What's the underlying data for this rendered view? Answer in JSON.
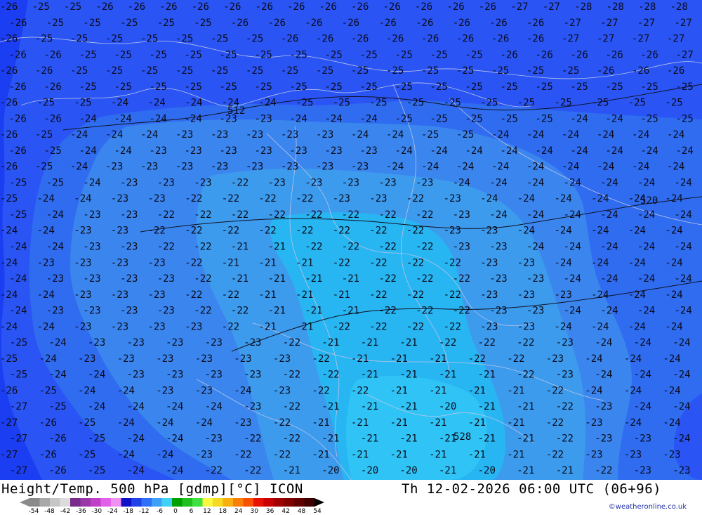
{
  "map": {
    "colors": {
      "band_26": "#1c3ef2",
      "band_25": "#2a55f4",
      "band_24": "#2f6cf0",
      "band_23": "#3b86ee",
      "band_22": "#3d9bee",
      "band_21": "#28b6f2",
      "contour": "#111122",
      "border": "#b9c3e6"
    },
    "temperature_labels": [
      {
        "row": 0,
        "values": [
          "-26",
          "-25",
          "-25",
          "-26",
          "-26",
          "-26",
          "-26",
          "-26",
          "-26",
          "-26",
          "-26",
          "-26",
          "-26",
          "-26",
          "-26",
          "-26",
          "-27",
          "-27",
          "-28",
          "-28",
          "-28",
          "-28"
        ]
      },
      {
        "row": 1,
        "values": [
          "-26",
          "-25",
          "-25",
          "-25",
          "-25",
          "-25",
          "-26",
          "-26",
          "-26",
          "-26",
          "-26",
          "-26",
          "-26",
          "-26",
          "-26",
          "-27",
          "-27",
          "-27",
          "-27"
        ]
      },
      {
        "row": 2,
        "values": [
          "-26",
          "-25",
          "-25",
          "-25",
          "-25",
          "-25",
          "-25",
          "-25",
          "-26",
          "-26",
          "-26",
          "-26",
          "-26",
          "-26",
          "-26",
          "-26",
          "-27",
          "-27",
          "-27",
          "-27"
        ]
      },
      {
        "row": 3,
        "values": [
          "-26",
          "-26",
          "-25",
          "-25",
          "-25",
          "-25",
          "-25",
          "-25",
          "-25",
          "-25",
          "-25",
          "-25",
          "-25",
          "-25",
          "-26",
          "-26",
          "-26",
          "-26",
          "-26",
          "-27"
        ]
      },
      {
        "row": 4,
        "values": [
          "-26",
          "-26",
          "-25",
          "-25",
          "-25",
          "-25",
          "-25",
          "-25",
          "-25",
          "-25",
          "-25",
          "-25",
          "-25",
          "-25",
          "-25",
          "-25",
          "-25",
          "-26",
          "-26",
          "-26"
        ]
      },
      {
        "row": 5,
        "values": [
          "-26",
          "-26",
          "-25",
          "-25",
          "-25",
          "-25",
          "-25",
          "-25",
          "-25",
          "-25",
          "-25",
          "-25",
          "-25",
          "-25",
          "-25",
          "-25",
          "-25",
          "-25",
          "-25",
          "-25"
        ]
      },
      {
        "row": 6,
        "values": [
          "-26",
          "-25",
          "-25",
          "-24",
          "-24",
          "-24",
          "-24",
          "-24",
          "-25",
          "-25",
          "-25",
          "-25",
          "-25",
          "-25",
          "-25",
          "-25",
          "-25",
          "-25",
          "-25"
        ]
      },
      {
        "row": 7,
        "values": [
          "-26",
          "-26",
          "-24",
          "-24",
          "-24",
          "-24",
          "-23",
          "-23",
          "-24",
          "-24",
          "-24",
          "-25",
          "-25",
          "-25",
          "-25",
          "-25",
          "-24",
          "-24",
          "-25",
          "-25"
        ]
      },
      {
        "row": 8,
        "values": [
          "-26",
          "-25",
          "-24",
          "-24",
          "-24",
          "-23",
          "-23",
          "-23",
          "-23",
          "-23",
          "-24",
          "-24",
          "-25",
          "-25",
          "-24",
          "-24",
          "-24",
          "-24",
          "-24",
          "-24"
        ]
      },
      {
        "row": 9,
        "values": [
          "-26",
          "-25",
          "-24",
          "-24",
          "-23",
          "-23",
          "-23",
          "-23",
          "-23",
          "-23",
          "-23",
          "-24",
          "-24",
          "-24",
          "-24",
          "-24",
          "-24",
          "-24",
          "-24",
          "-24"
        ]
      },
      {
        "row": 10,
        "values": [
          "-26",
          "-25",
          "-24",
          "-23",
          "-23",
          "-23",
          "-23",
          "-23",
          "-23",
          "-23",
          "-23",
          "-24",
          "-24",
          "-24",
          "-24",
          "-24",
          "-24",
          "-24",
          "-24",
          "-24"
        ]
      },
      {
        "row": 11,
        "values": [
          "-25",
          "-25",
          "-24",
          "-23",
          "-23",
          "-23",
          "-22",
          "-23",
          "-23",
          "-23",
          "-23",
          "-23",
          "-24",
          "-24",
          "-24",
          "-24",
          "-24",
          "-24",
          "-24"
        ]
      },
      {
        "row": 12,
        "values": [
          "-25",
          "-24",
          "-24",
          "-23",
          "-23",
          "-22",
          "-22",
          "-22",
          "-22",
          "-23",
          "-23",
          "-22",
          "-23",
          "-24",
          "-24",
          "-24",
          "-24",
          "-24",
          "-24"
        ]
      },
      {
        "row": 13,
        "values": [
          "-25",
          "-24",
          "-23",
          "-23",
          "-22",
          "-22",
          "-22",
          "-22",
          "-22",
          "-22",
          "-22",
          "-22",
          "-23",
          "-24",
          "-24",
          "-24",
          "-24",
          "-24",
          "-24"
        ]
      },
      {
        "row": 14,
        "values": [
          "-24",
          "-24",
          "-23",
          "-23",
          "-22",
          "-22",
          "-22",
          "-22",
          "-22",
          "-22",
          "-22",
          "-22",
          "-23",
          "-23",
          "-24",
          "-24",
          "-24",
          "-24",
          "-24"
        ]
      },
      {
        "row": 15,
        "values": [
          "-24",
          "-24",
          "-23",
          "-23",
          "-22",
          "-22",
          "-21",
          "-21",
          "-22",
          "-22",
          "-22",
          "-22",
          "-23",
          "-23",
          "-24",
          "-24",
          "-24",
          "-24",
          "-24"
        ]
      },
      {
        "row": 16,
        "values": [
          "-24",
          "-23",
          "-23",
          "-23",
          "-23",
          "-22",
          "-21",
          "-21",
          "-21",
          "-22",
          "-22",
          "-22",
          "-22",
          "-23",
          "-23",
          "-24",
          "-24",
          "-24",
          "-24"
        ]
      },
      {
        "row": 17,
        "values": [
          "-24",
          "-23",
          "-23",
          "-23",
          "-23",
          "-22",
          "-21",
          "-21",
          "-21",
          "-21",
          "-22",
          "-22",
          "-22",
          "-23",
          "-23",
          "-24",
          "-24",
          "-24",
          "-24"
        ]
      },
      {
        "row": 18,
        "values": [
          "-24",
          "-24",
          "-23",
          "-23",
          "-23",
          "-22",
          "-22",
          "-21",
          "-21",
          "-21",
          "-22",
          "-22",
          "-22",
          "-23",
          "-23",
          "-23",
          "-24",
          "-24",
          "-24"
        ]
      },
      {
        "row": 19,
        "values": [
          "-24",
          "-23",
          "-23",
          "-23",
          "-23",
          "-22",
          "-22",
          "-21",
          "-21",
          "-21",
          "-22",
          "-22",
          "-22",
          "-23",
          "-23",
          "-24",
          "-24",
          "-24",
          "-24"
        ]
      },
      {
        "row": 20,
        "values": [
          "-24",
          "-24",
          "-23",
          "-23",
          "-23",
          "-23",
          "-22",
          "-21",
          "-21",
          "-22",
          "-22",
          "-22",
          "-22",
          "-23",
          "-23",
          "-24",
          "-24",
          "-24",
          "-24"
        ]
      },
      {
        "row": 21,
        "values": [
          "-25",
          "-24",
          "-23",
          "-23",
          "-23",
          "-23",
          "-23",
          "-22",
          "-21",
          "-21",
          "-21",
          "-22",
          "-22",
          "-22",
          "-23",
          "-24",
          "-24",
          "-24"
        ]
      },
      {
        "row": 22,
        "values": [
          "-25",
          "-24",
          "-23",
          "-23",
          "-23",
          "-23",
          "-23",
          "-23",
          "-22",
          "-21",
          "-21",
          "-21",
          "-22",
          "-22",
          "-23",
          "-24",
          "-24",
          "-24"
        ]
      },
      {
        "row": 23,
        "values": [
          "-25",
          "-24",
          "-24",
          "-23",
          "-23",
          "-23",
          "-23",
          "-22",
          "-22",
          "-21",
          "-21",
          "-21",
          "-21",
          "-22",
          "-23",
          "-24",
          "-24",
          "-24"
        ]
      },
      {
        "row": 24,
        "values": [
          "-26",
          "-25",
          "-24",
          "-24",
          "-23",
          "-23",
          "-24",
          "-23",
          "-22",
          "-22",
          "-21",
          "-21",
          "-21",
          "-21",
          "-22",
          "-24",
          "-24",
          "-24"
        ]
      },
      {
        "row": 25,
        "values": [
          "-27",
          "-25",
          "-24",
          "-24",
          "-24",
          "-24",
          "-23",
          "-22",
          "-21",
          "-21",
          "-21",
          "-20",
          "-21",
          "-21",
          "-22",
          "-23",
          "-24",
          "-24"
        ]
      },
      {
        "row": 26,
        "values": [
          "-27",
          "-26",
          "-25",
          "-24",
          "-24",
          "-24",
          "-23",
          "-22",
          "-21",
          "-21",
          "-21",
          "-21",
          "-21",
          "-21",
          "-22",
          "-23",
          "-24",
          "-24"
        ]
      },
      {
        "row": 27,
        "values": [
          "-27",
          "-26",
          "-25",
          "-24",
          "-24",
          "-23",
          "-22",
          "-22",
          "-21",
          "-21",
          "-21",
          "-21",
          "-21",
          "-21",
          "-22",
          "-23",
          "-23",
          "-24"
        ]
      },
      {
        "row": 28,
        "values": [
          "-27",
          "-26",
          "-25",
          "-24",
          "-24",
          "-23",
          "-22",
          "-22",
          "-21",
          "-21",
          "-21",
          "-21",
          "-21",
          "-21",
          "-22",
          "-23",
          "-23",
          "-23"
        ]
      },
      {
        "row": 29,
        "values": [
          "-27",
          "-26",
          "-25",
          "-24",
          "-24",
          "-22",
          "-22",
          "-21",
          "-20",
          "-20",
          "-20",
          "-21",
          "-20",
          "-21",
          "-21",
          "-22",
          "-23",
          "-23"
        ]
      }
    ],
    "height_labels": [
      {
        "text": "512"
      },
      {
        "text": "520"
      },
      {
        "text": "528"
      }
    ]
  },
  "footer": {
    "title": "Height/Temp. 500 hPa [gdmp][°C] ICON",
    "timestamp": "Th 12-02-2026 06:00 UTC (06+96)",
    "credit": "©weatheronline.co.uk",
    "scale_ticks": [
      "-54",
      "-48",
      "-42",
      "-36",
      "-30",
      "-24",
      "-18",
      "-12",
      "-6",
      "0",
      "6",
      "12",
      "18",
      "24",
      "30",
      "36",
      "42",
      "48",
      "54"
    ],
    "scale_colors": [
      "#8a8a8a",
      "#a8a8a8",
      "#c6c6c6",
      "#dcdcdc",
      "#7a2a8a",
      "#9a38a8",
      "#c040c8",
      "#e060e8",
      "#f090f0",
      "#1010c8",
      "#2040e8",
      "#3070f8",
      "#40a0f8",
      "#40d0f8",
      "#00a000",
      "#20c020",
      "#40e040",
      "#f8f840",
      "#f8d820",
      "#f8b010",
      "#f88008",
      "#f85000",
      "#e81000",
      "#c80000",
      "#a00000",
      "#800000",
      "#600000",
      "#400000"
    ]
  }
}
